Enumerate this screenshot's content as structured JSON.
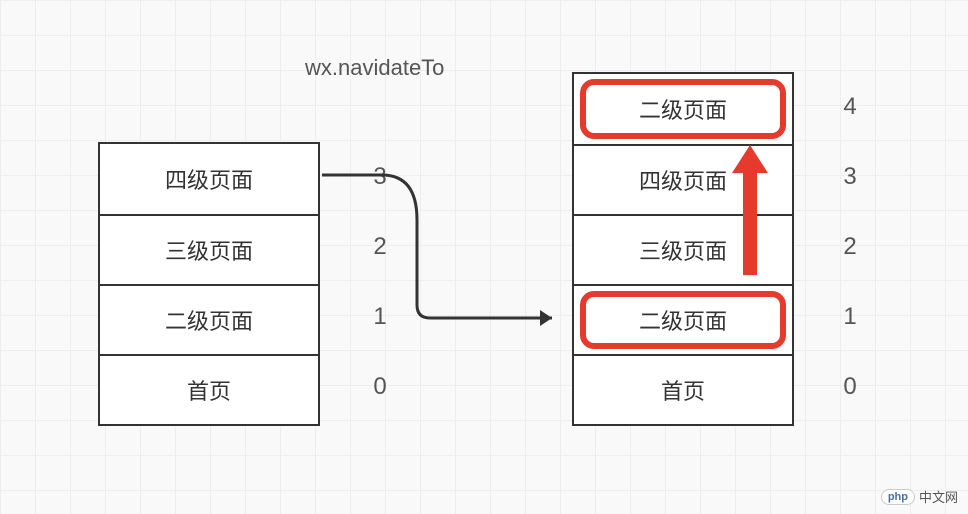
{
  "title": "wx.navidateTo",
  "left_stack": [
    {
      "label": "四级页面",
      "index": "3",
      "highlight": false
    },
    {
      "label": "三级页面",
      "index": "2",
      "highlight": false
    },
    {
      "label": "二级页面",
      "index": "1",
      "highlight": false
    },
    {
      "label": "首页",
      "index": "0",
      "highlight": false
    }
  ],
  "right_stack": [
    {
      "label": "二级页面",
      "index": "4",
      "highlight": true
    },
    {
      "label": "四级页面",
      "index": "3",
      "highlight": false
    },
    {
      "label": "三级页面",
      "index": "2",
      "highlight": false
    },
    {
      "label": "二级页面",
      "index": "1",
      "highlight": true
    },
    {
      "label": "首页",
      "index": "0",
      "highlight": false
    }
  ],
  "watermark": {
    "badge": "php",
    "text": "中文网"
  }
}
